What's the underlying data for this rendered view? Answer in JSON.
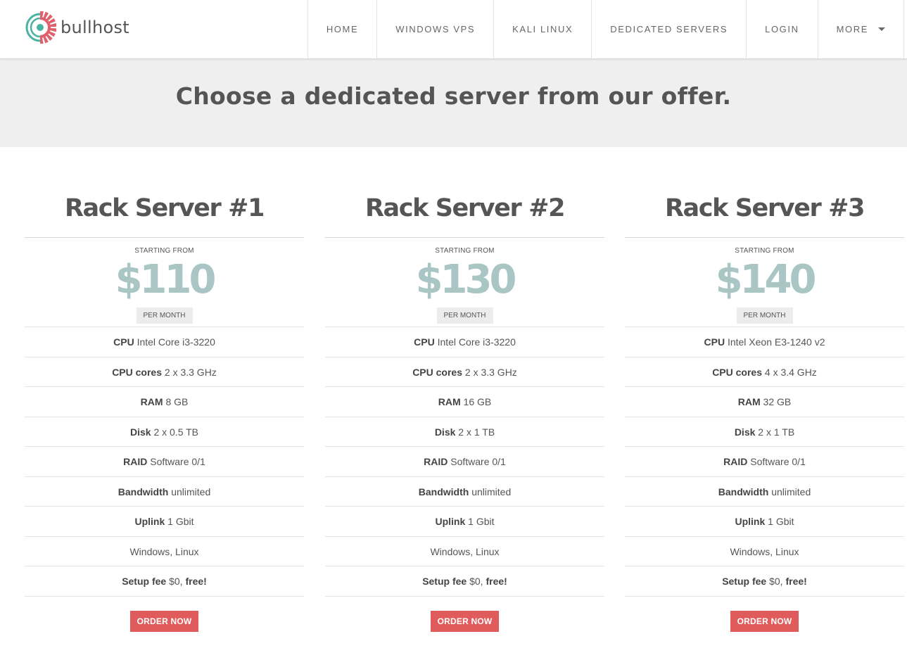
{
  "brand": {
    "name": "bullhost"
  },
  "nav": [
    {
      "label": "HOME"
    },
    {
      "label": "WINDOWS VPS"
    },
    {
      "label": "KALI LINUX"
    },
    {
      "label": "DEDICATED SERVERS"
    },
    {
      "label": "LOGIN"
    },
    {
      "label": "MORE"
    }
  ],
  "banner": {
    "title": "Choose a dedicated server from our offer."
  },
  "plans": [
    {
      "title": "Rack Server #1",
      "starting_from": "STARTING FROM",
      "price": "$110",
      "per_month": "PER MONTH",
      "specs": [
        {
          "label": "CPU",
          "value": "Intel Core i3-3220"
        },
        {
          "label": "CPU cores",
          "value": "2 x 3.3 GHz"
        },
        {
          "label": "RAM",
          "value": "8 GB"
        },
        {
          "label": "Disk",
          "value": "2 x 0.5 TB"
        },
        {
          "label": "RAID",
          "value": "Software 0/1"
        },
        {
          "label": "Bandwidth",
          "value": "unlimited"
        },
        {
          "label": "Uplink",
          "value": "1 Gbit"
        },
        {
          "label": "",
          "value": "Windows, Linux"
        },
        {
          "label": "Setup fee",
          "value": "$0,",
          "extra": "free!"
        }
      ],
      "order_label": "ORDER NOW"
    },
    {
      "title": "Rack Server #2",
      "starting_from": "STARTING FROM",
      "price": "$130",
      "per_month": "PER MONTH",
      "specs": [
        {
          "label": "CPU",
          "value": "Intel Core i3-3220"
        },
        {
          "label": "CPU cores",
          "value": "2 x 3.3 GHz"
        },
        {
          "label": "RAM",
          "value": "16 GB"
        },
        {
          "label": "Disk",
          "value": "2 x 1 TB"
        },
        {
          "label": "RAID",
          "value": "Software 0/1"
        },
        {
          "label": "Bandwidth",
          "value": "unlimited"
        },
        {
          "label": "Uplink",
          "value": "1 Gbit"
        },
        {
          "label": "",
          "value": "Windows, Linux"
        },
        {
          "label": "Setup fee",
          "value": "$0,",
          "extra": "free!"
        }
      ],
      "order_label": "ORDER NOW"
    },
    {
      "title": "Rack Server #3",
      "starting_from": "STARTING FROM",
      "price": "$140",
      "per_month": "PER MONTH",
      "specs": [
        {
          "label": "CPU",
          "value": "Intel Xeon E3-1240 v2"
        },
        {
          "label": "CPU cores",
          "value": "4 x 3.4 GHz"
        },
        {
          "label": "RAM",
          "value": "32 GB"
        },
        {
          "label": "Disk",
          "value": "2 x 1 TB"
        },
        {
          "label": "RAID",
          "value": "Software 0/1"
        },
        {
          "label": "Bandwidth",
          "value": "unlimited"
        },
        {
          "label": "Uplink",
          "value": "1 Gbit"
        },
        {
          "label": "",
          "value": "Windows, Linux"
        },
        {
          "label": "Setup fee",
          "value": "$0,",
          "extra": "free!"
        }
      ],
      "order_label": "ORDER NOW"
    }
  ],
  "colors": {
    "accent_red": "#e05c5c",
    "price_teal": "#a9c5c4",
    "logo_teal": "#4bb3a3",
    "logo_red": "#e0606b"
  }
}
